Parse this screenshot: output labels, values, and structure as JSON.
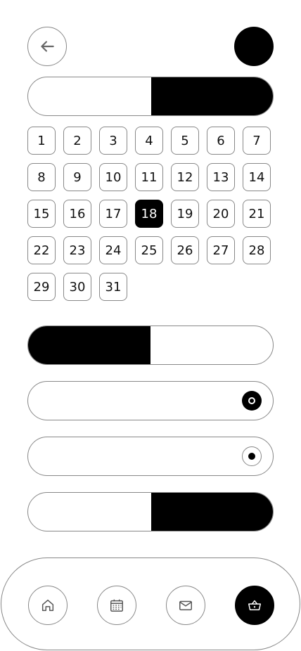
{
  "header": {
    "back_icon": "arrow-left-icon",
    "avatar_color": "#000000"
  },
  "toggles": [
    {
      "name": "toggle-1",
      "active_side": "right"
    },
    {
      "name": "toggle-2",
      "active_side": "left"
    },
    {
      "name": "toggle-3",
      "active_side": "right"
    }
  ],
  "calendar": {
    "days": [
      "1",
      "2",
      "3",
      "4",
      "5",
      "6",
      "7",
      "8",
      "9",
      "10",
      "11",
      "12",
      "13",
      "14",
      "15",
      "16",
      "17",
      "18",
      "19",
      "20",
      "21",
      "22",
      "23",
      "24",
      "25",
      "26",
      "27",
      "28",
      "29",
      "30",
      "31"
    ],
    "selected_day": "18"
  },
  "radios": [
    {
      "name": "radio-option-1",
      "style": "filled"
    },
    {
      "name": "radio-option-2",
      "style": "outlined"
    }
  ],
  "nav": {
    "items": [
      {
        "name": "home",
        "icon": "home-icon",
        "active": false
      },
      {
        "name": "calendar",
        "icon": "calendar-icon",
        "active": false
      },
      {
        "name": "mail",
        "icon": "mail-icon",
        "active": false
      },
      {
        "name": "basket",
        "icon": "basket-icon",
        "active": true
      }
    ]
  },
  "colors": {
    "accent": "#000000",
    "border": "#888888",
    "background": "#ffffff"
  }
}
